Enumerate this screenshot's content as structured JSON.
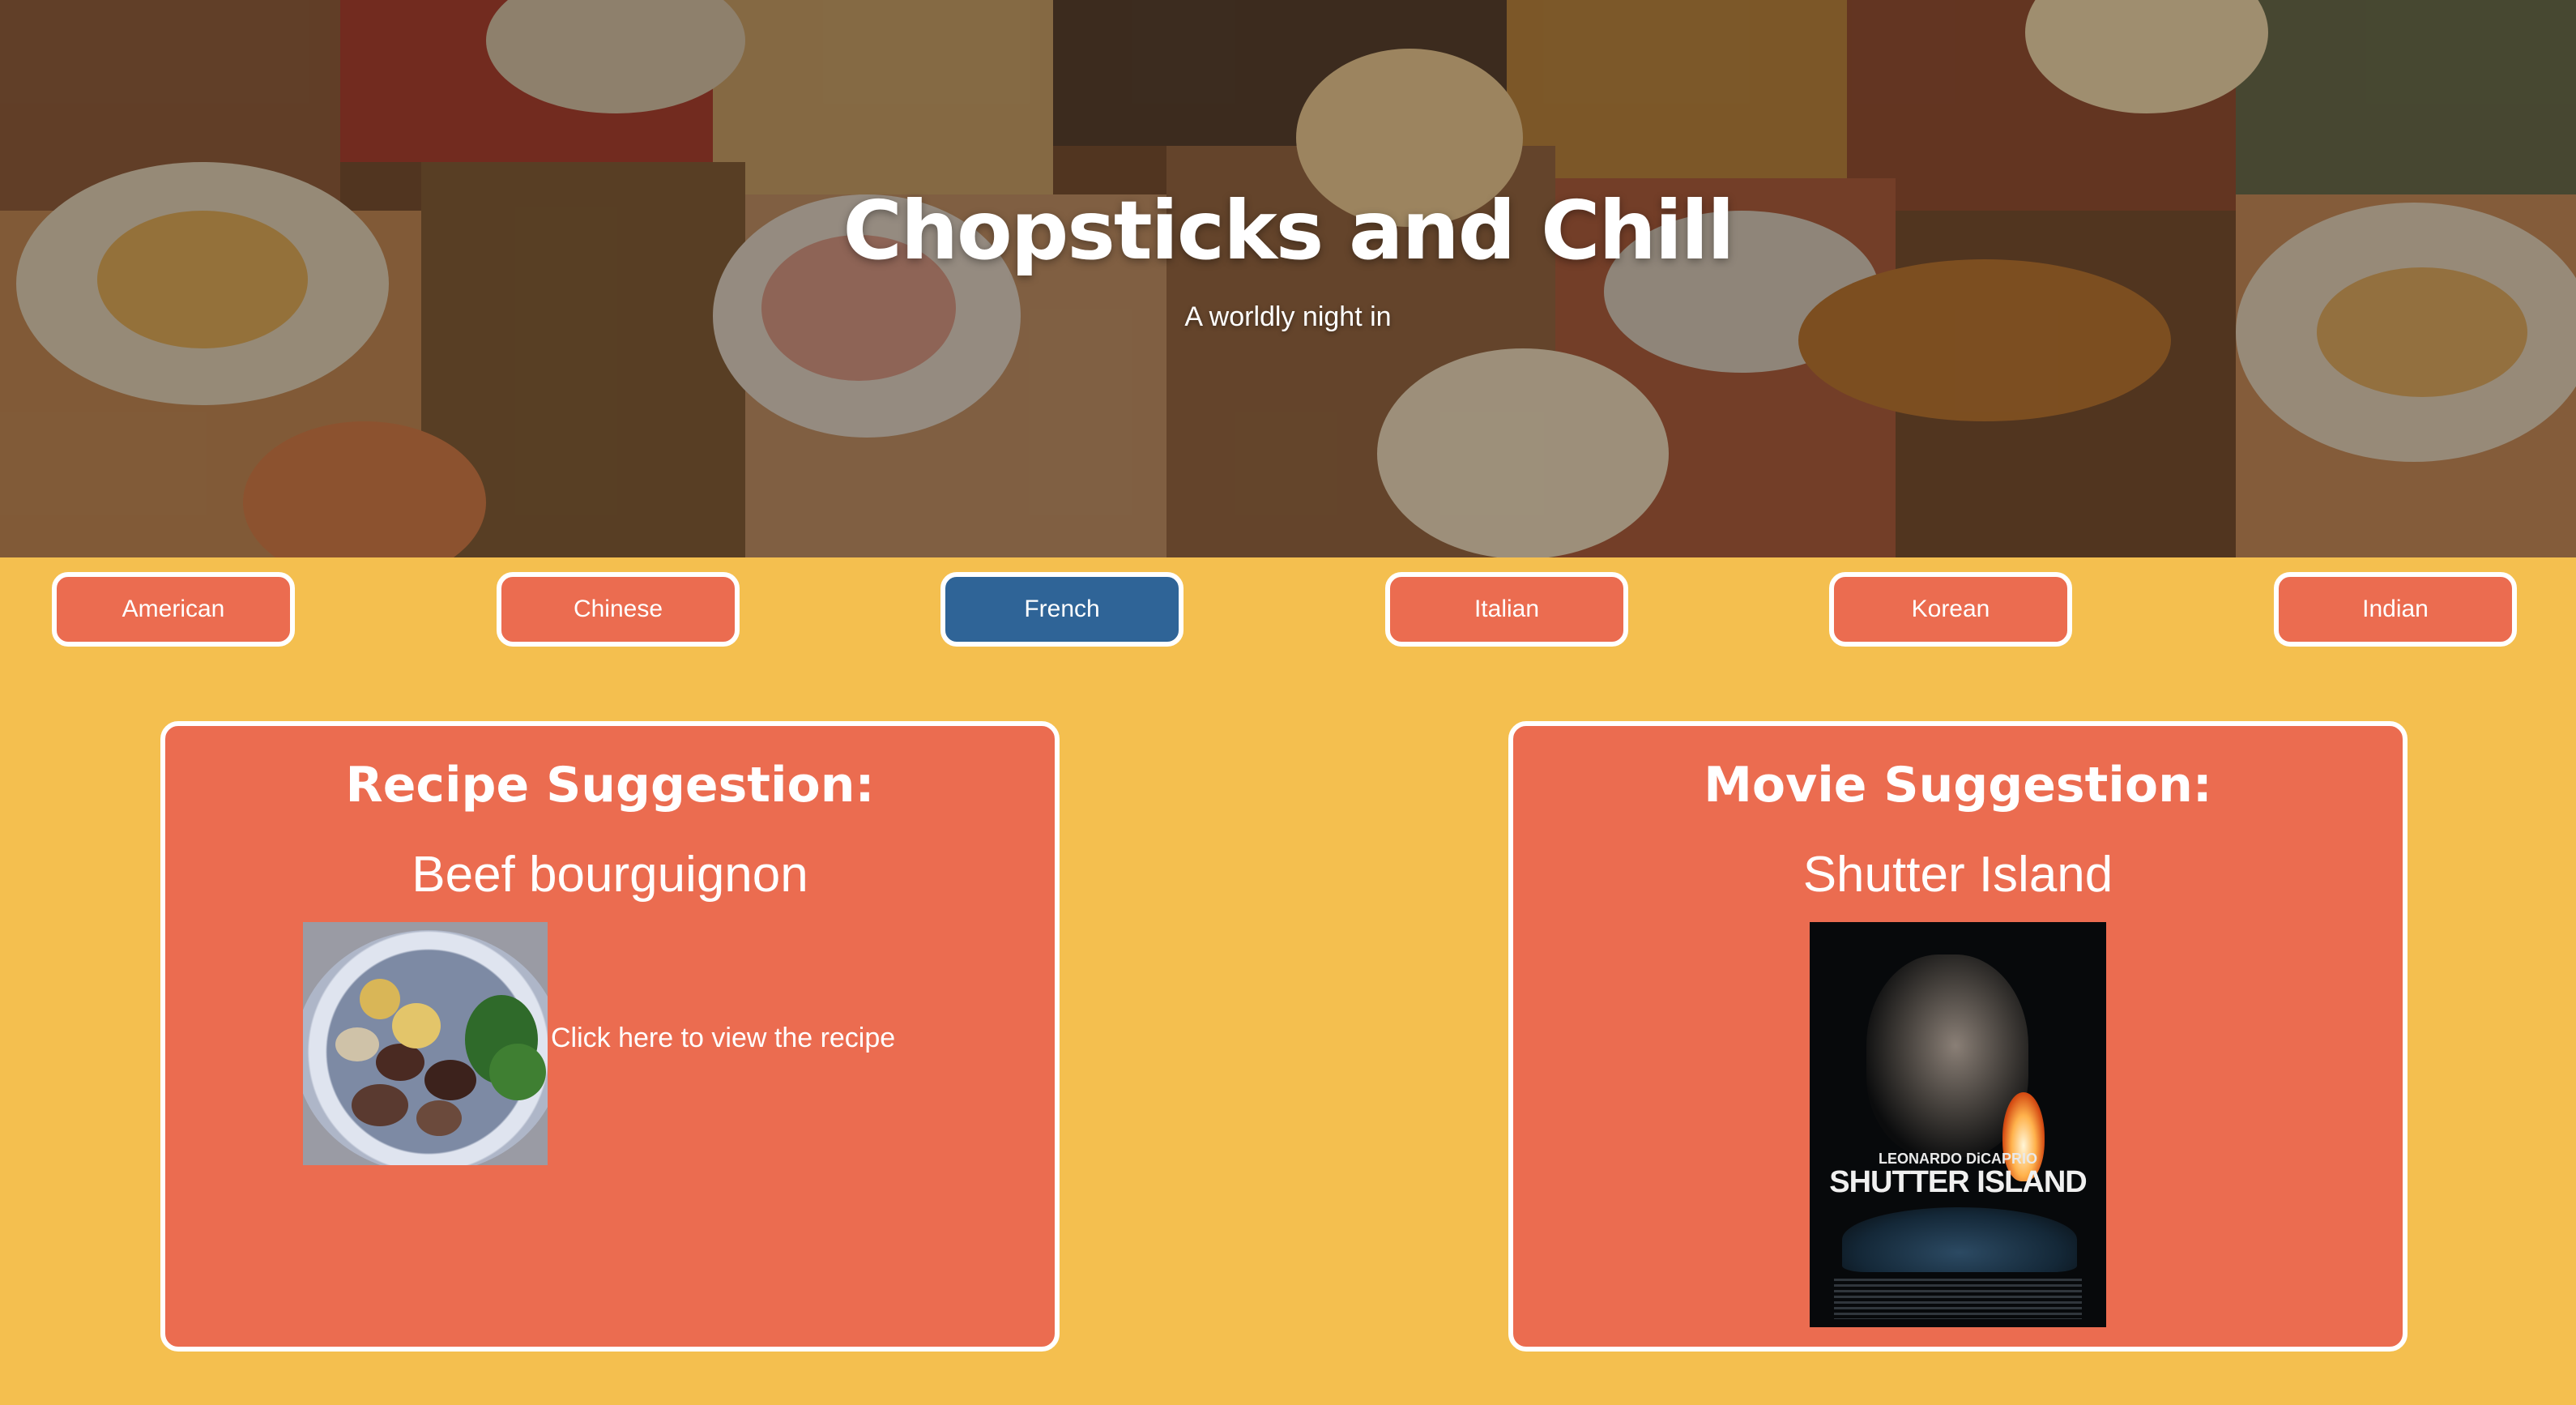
{
  "hero": {
    "title": "Chopsticks and Chill",
    "subtitle": "A worldly night in"
  },
  "cuisines": [
    {
      "label": "American",
      "active": false
    },
    {
      "label": "Chinese",
      "active": false
    },
    {
      "label": "French",
      "active": true
    },
    {
      "label": "Italian",
      "active": false
    },
    {
      "label": "Korean",
      "active": false
    },
    {
      "label": "Indian",
      "active": false
    }
  ],
  "recipe": {
    "heading": "Recipe Suggestion:",
    "name": "Beef bourguignon",
    "link_text": "Click here to view the recipe",
    "image": "beef-bourguignon-photo"
  },
  "movie": {
    "heading": "Movie Suggestion:",
    "name": "Shutter Island",
    "poster": {
      "actor": "LEONARDO DiCAPRIO",
      "title": "SHUTTER ISLAND"
    }
  },
  "colors": {
    "page_background": "#f4bf4f",
    "button": "#eb6c50",
    "button_active": "#2f6497",
    "card": "#eb6c50",
    "border": "#ffffff"
  }
}
